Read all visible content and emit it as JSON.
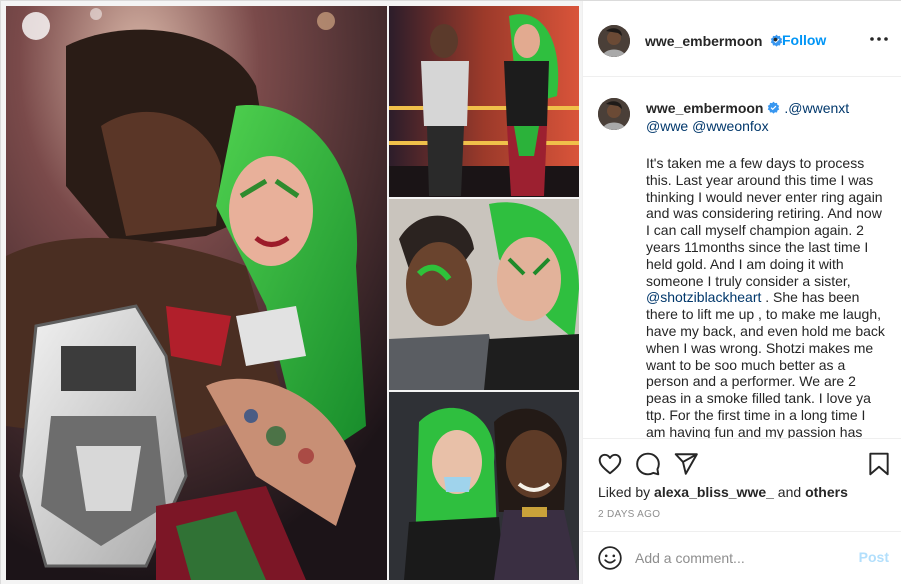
{
  "post": {
    "media": {
      "main_photo": "champion-hug-photo",
      "top_right_photo": "ring-photo",
      "middle_right_photo": "selfie-photo",
      "bottom_right_photo": "duo-photo"
    },
    "header": {
      "username": "wwe_embermoon",
      "dot": "•",
      "follow_label": "Follow",
      "more_icon": "more-horizontal-icon"
    },
    "caption": {
      "username": "wwe_embermoon",
      "mention_1": ".@wwenxt",
      "mention_2": "@wwe",
      "mention_3": "@wweonfox",
      "body_part_1": "It's taken me a few days to process this. Last year around this time I was thinking I would never enter ring again and was considering retiring. And now I can call myself champion again. 2 years 11months since the last time I held gold. And I am doing it with someone I truly consider a sister, ",
      "mention_4": "@shotziblackheart",
      "body_part_2": " . She has been there to lift me up , to make me laugh, have my back, and even hold me back when I was wrong. Shotzi makes me want to be soo much better as a person and a performer. We are 2 peas in a smoke filled tank. I love ya ttp. For the first time in a long time I am having fun and my passion has"
    },
    "actions": {
      "like_icon": "heart-icon",
      "comment_icon": "speech-bubble-icon",
      "share_icon": "paper-plane-icon",
      "save_icon": "bookmark-icon"
    },
    "likes": {
      "prefix": "Liked by ",
      "user": "alexa_bliss_wwe_",
      "joiner": " and ",
      "others": "others"
    },
    "timestamp": "2 DAYS AGO",
    "add_comment": {
      "emoji_icon": "smiley-icon",
      "placeholder": "Add a comment...",
      "post_label": "Post"
    },
    "colors": {
      "accent": "#0095f6",
      "text": "#262626",
      "muted": "#8e8e8e",
      "post_disabled": "#b2dffc",
      "verified": "#3897f0"
    }
  }
}
